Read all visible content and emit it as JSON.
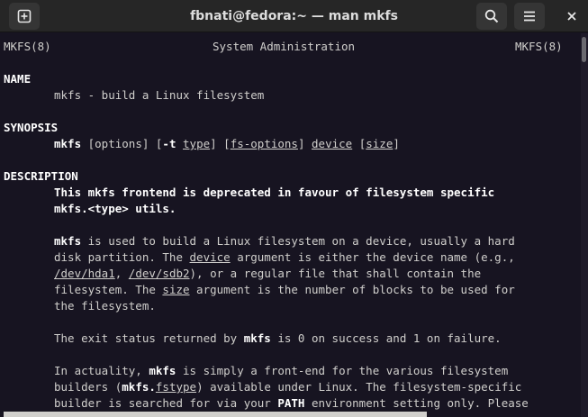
{
  "window": {
    "title": "fbnati@fedora:~ — man mkfs",
    "icons": {
      "new_tab": "new-tab-icon",
      "search": "search-icon",
      "menu": "hamburger-menu-icon",
      "close": "close-icon"
    }
  },
  "man": {
    "header_left": "MKFS(8)",
    "header_center": "System Administration",
    "header_right": "MKFS(8)",
    "name_heading": "NAME",
    "name_text": "mkfs - build a Linux filesystem",
    "synopsis_heading": "SYNOPSIS",
    "synopsis": {
      "cmd": "mkfs",
      "t1": " [options] [",
      "opt_t": "-t",
      "t2": " ",
      "type": "type",
      "t3": "] [",
      "fs_options": "fs-options",
      "t4": "] ",
      "device": "device",
      "t5": " [",
      "size": "size",
      "t6": "]"
    },
    "description_heading": "DESCRIPTION",
    "dep_line1": "This mkfs frontend is deprecated in favour of filesystem specific",
    "dep_line2": "mkfs.<type> utils.",
    "p1": {
      "l1_cmd": "mkfs",
      "l1_rest": " is used to build a Linux filesystem on a device, usually a hard",
      "l2_a": "disk partition. The ",
      "l2_device": "device",
      "l2_b": " argument is either the device name (e.g.,",
      "l3_hda1": "/dev/hda1",
      "l3_a": ", ",
      "l3_sdb2": "/dev/sdb2",
      "l3_b": "), or a regular file that shall contain the",
      "l4_a": "filesystem. The ",
      "l4_size": "size",
      "l4_b": " argument is the number of blocks to be used for",
      "l5": "the filesystem."
    },
    "p2": {
      "a": "The exit status returned by ",
      "cmd": "mkfs",
      "b": " is 0 on success and 1 on failure."
    },
    "p3": {
      "l1_a": "In actuality, ",
      "l1_cmd": "mkfs",
      "l1_b": " is simply a front-end for the various filesystem",
      "l2_a": "builders (",
      "l2_cmd": "mkfs.",
      "l2_fstype": "fstype",
      "l2_b": ") available under Linux. The filesystem-specific",
      "l3_a": "builder is searched for via your ",
      "l3_path": "PATH",
      "l3_b": " environment setting only. Please"
    }
  }
}
